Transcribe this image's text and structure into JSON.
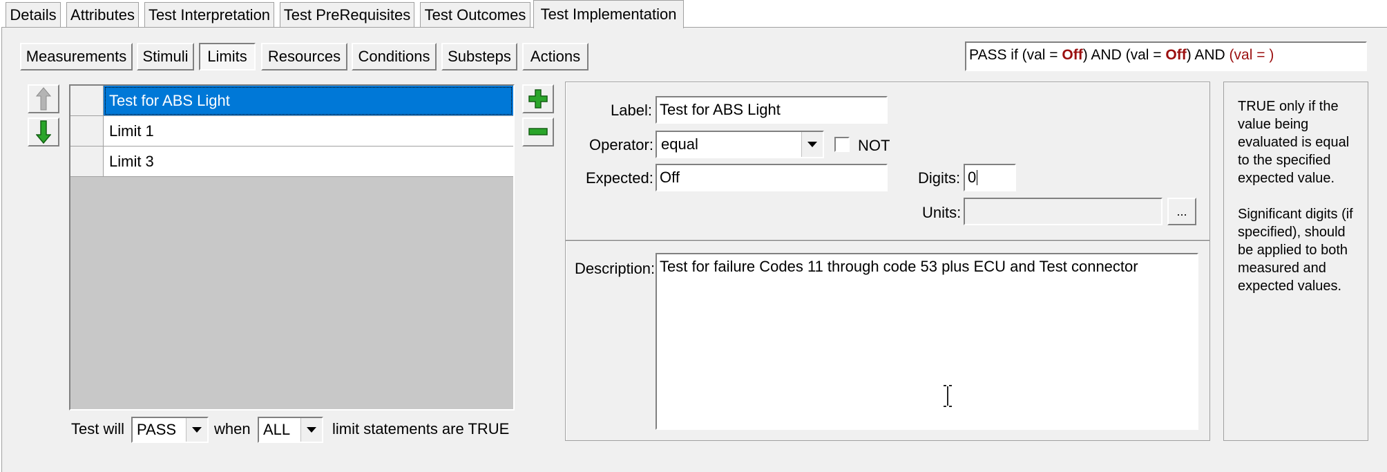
{
  "tabs": [
    "Details",
    "Attributes",
    "Test Interpretation",
    "Test PreRequisites",
    "Test Outcomes",
    "Test Implementation"
  ],
  "active_tab": "Test Implementation",
  "subtabs": [
    "Measurements",
    "Stimuli",
    "Limits",
    "Resources",
    "Conditions",
    "Substeps",
    "Actions"
  ],
  "active_subtab": "Limits",
  "formula": {
    "p1": "PASS if (val = ",
    "v1": "Off",
    "p2": ") AND (val = ",
    "v2": "Off",
    "p3": ") AND ",
    "tail": "(val = )"
  },
  "limits": [
    "Test for ABS Light",
    "Limit 1",
    "Limit 3"
  ],
  "selected_limit": "Test for ABS Light",
  "footer": {
    "test_will": "Test will",
    "pass_value": "PASS",
    "when": "when",
    "all_value": "ALL",
    "suffix": "limit statements are TRUE"
  },
  "form": {
    "label_caption": "Label:",
    "label_value": "Test for ABS Light",
    "operator_caption": "Operator:",
    "operator_value": "equal",
    "not_caption": "NOT",
    "not_checked": false,
    "expected_caption": "Expected:",
    "expected_value": "Off",
    "digits_caption": "Digits:",
    "digits_value": "0",
    "units_caption": "Units:",
    "units_value": "",
    "units_button": "...",
    "description_caption": "Description:",
    "description_value": "Test for failure Codes 11 through code 53 plus ECU and Test connector"
  },
  "help": {
    "para1": "TRUE only if the value being evaluated is equal to the specified expected value.",
    "para2": "Significant digits (if specified), should be applied to both measured and expected values."
  },
  "colors": {
    "selection": "#0078d7",
    "formula_value": "#9b0f0f",
    "plus_green": "#1f9e1f",
    "minus_green": "#1f9e1f"
  }
}
